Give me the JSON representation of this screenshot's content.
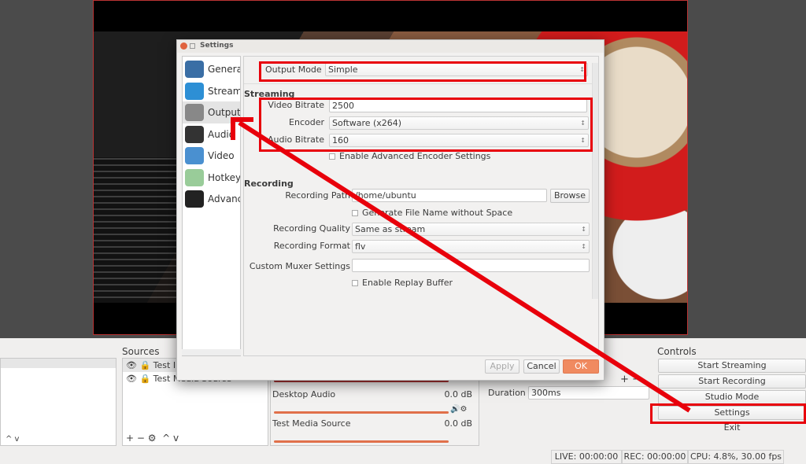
{
  "dialog": {
    "title": "Settings",
    "nav": [
      {
        "label": "General",
        "icon": "general-icon"
      },
      {
        "label": "Stream",
        "icon": "globe-icon"
      },
      {
        "label": "Output",
        "icon": "antenna-icon"
      },
      {
        "label": "Audio",
        "icon": "speaker-icon"
      },
      {
        "label": "Video",
        "icon": "monitor-icon"
      },
      {
        "label": "Hotkeys",
        "icon": "keyboard-icon"
      },
      {
        "label": "Advanced",
        "icon": "gears-icon"
      }
    ],
    "output_mode_label": "Output Mode",
    "output_mode": "Simple",
    "streaming": {
      "heading": "Streaming",
      "video_bitrate_label": "Video Bitrate",
      "video_bitrate": "2500",
      "encoder_label": "Encoder",
      "encoder": "Software (x264)",
      "audio_bitrate_label": "Audio Bitrate",
      "audio_bitrate": "160",
      "advanced_label": "Enable Advanced Encoder Settings"
    },
    "recording": {
      "heading": "Recording",
      "path_label": "Recording Path",
      "path": "/home/ubuntu",
      "browse": "Browse",
      "gen_filename_label": "Generate File Name without Space",
      "quality_label": "Recording Quality",
      "quality": "Same as stream",
      "format_label": "Recording Format",
      "format": "flv",
      "muxer_label": "Custom Muxer Settings",
      "muxer": "",
      "replay_label": "Enable Replay Buffer"
    },
    "apply": "Apply",
    "cancel": "Cancel",
    "ok": "OK"
  },
  "sources": {
    "title": "Sources",
    "items": [
      "Test Image",
      "Test Media Source"
    ]
  },
  "mixer": {
    "channels": [
      {
        "name": "Desktop Audio",
        "level": "0.0 dB"
      },
      {
        "name": "Test Media Source",
        "level": "0.0 dB"
      }
    ]
  },
  "transitions": {
    "duration_label": "Duration",
    "duration": "300ms"
  },
  "controls": {
    "title": "Controls",
    "buttons": [
      "Start Streaming",
      "Start Recording",
      "Studio Mode",
      "Settings",
      "Exit"
    ]
  },
  "status": {
    "live": "LIVE: 00:00:00",
    "rec": "REC: 00:00:00",
    "cpu": "CPU: 4.8%, 30.00 fps"
  },
  "annotation_color": "#e8000b",
  "accent": "#f08a60"
}
